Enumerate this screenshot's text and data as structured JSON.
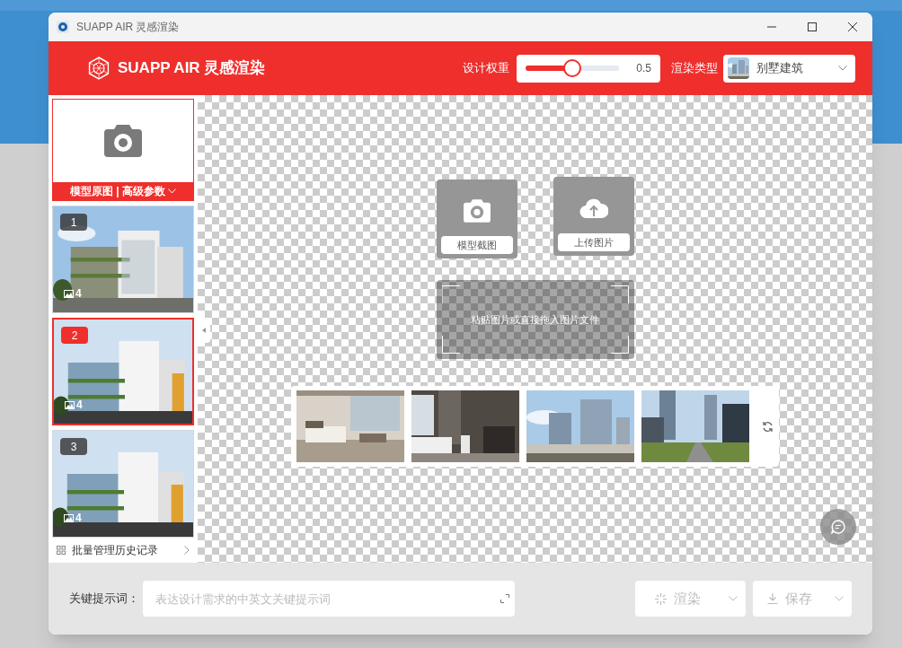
{
  "window": {
    "title": "SUAPP AIR 灵感渲染"
  },
  "header": {
    "brand": "SUAPP AIR 灵感渲染",
    "weight": {
      "label": "设计权重",
      "level": 0.5,
      "reading": "0.5"
    },
    "render_type": {
      "label": "渲染类型",
      "value": "别墅建筑"
    }
  },
  "sidebar": {
    "source": {
      "caption": "模型原图 | 高级参数"
    },
    "history": [
      {
        "number": "1",
        "count": "4",
        "selected": false
      },
      {
        "number": "2",
        "count": "4",
        "selected": true
      },
      {
        "number": "3",
        "count": "4",
        "selected": false
      }
    ],
    "batch_link": "批量管理历史记录"
  },
  "canvas": {
    "actions": [
      {
        "label": "模型截图",
        "kind": "camera"
      },
      {
        "label": "上传图片",
        "kind": "upload"
      }
    ],
    "drop_zone": "粘贴图片或直接拖入图片文件"
  },
  "bottom": {
    "prompt_label": "关键提示词：",
    "prompt_placeholder": "表达设计需求的中英文关键提示词",
    "buttons": [
      {
        "label": "渲染",
        "kind": "render",
        "disabled": true
      },
      {
        "label": "保存",
        "kind": "save",
        "disabled": true
      }
    ]
  }
}
